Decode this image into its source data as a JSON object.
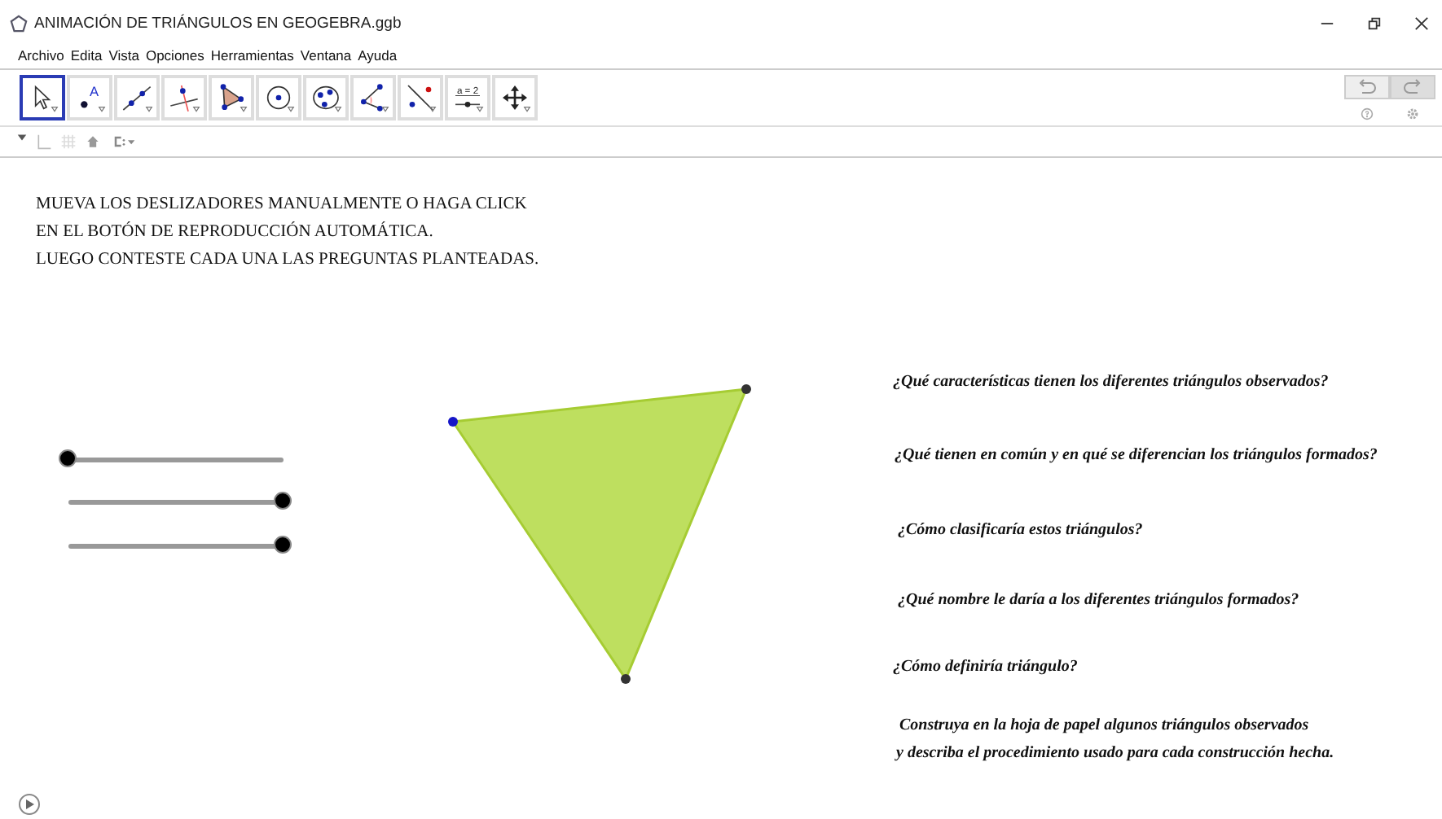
{
  "window": {
    "title": "ANIMACIÓN DE TRIÁNGULOS EN GEOGEBRA.ggb"
  },
  "menu": [
    "Archivo",
    "Edita",
    "Vista",
    "Opciones",
    "Herramientas",
    "Ventana",
    "Ayuda"
  ],
  "tools": [
    {
      "kind": "move",
      "selected": true
    },
    {
      "kind": "point",
      "glyph": "A",
      "selected": false
    },
    {
      "kind": "line",
      "selected": false
    },
    {
      "kind": "perpendicular",
      "selected": false
    },
    {
      "kind": "polygon",
      "selected": false
    },
    {
      "kind": "circle",
      "selected": false
    },
    {
      "kind": "ellipse",
      "selected": false
    },
    {
      "kind": "angle",
      "selected": false
    },
    {
      "kind": "reflect",
      "selected": false
    },
    {
      "kind": "slider",
      "glyph": "a = 2",
      "selected": false
    },
    {
      "kind": "pan",
      "selected": false
    }
  ],
  "instructions": [
    "MUEVA LOS DESLIZADORES MANUALMENTE O HAGA CLICK",
    "EN EL BOTÓN DE REPRODUCCIÓN AUTOMÁTICA.",
    "LUEGO CONTESTE CADA UNA LAS PREGUNTAS PLANTEADAS."
  ],
  "sliders": [
    {
      "level": 0
    },
    {
      "level": 1
    },
    {
      "level": 1
    }
  ],
  "questions": [
    "¿Qué características tienen los diferentes triángulos observados?",
    "¿Qué tienen en común y en qué se diferencian los triángulos formados?",
    "¿Cómo clasificaría estos triángulos?",
    "¿Qué nombre le daría a los diferentes triángulos formados?",
    "¿Cómo definiría triángulo?"
  ],
  "task": [
    "Construya en la hoja de papel algunos triángulos observados",
    "y describa el procedimiento usado para cada construcción hecha."
  ]
}
